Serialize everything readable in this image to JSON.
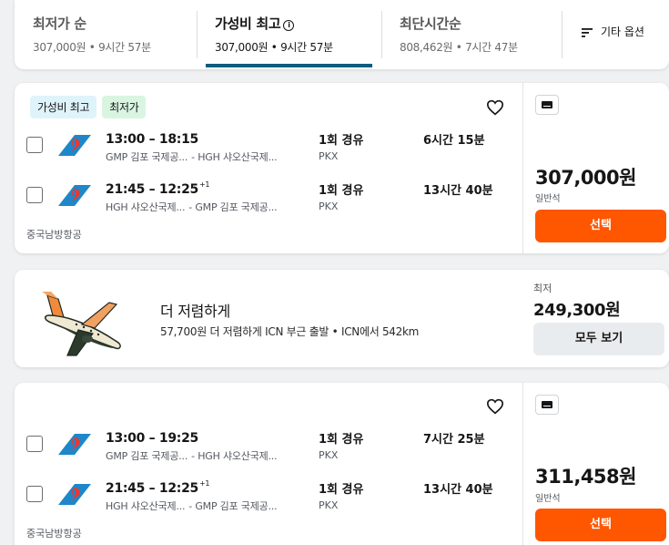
{
  "sort": {
    "tabs": [
      {
        "label": "최저가 순",
        "price": "307,000원",
        "duration": "9시간 57분"
      },
      {
        "label": "가성비 최고",
        "price": "307,000원",
        "duration": "9시간 57분"
      },
      {
        "label": "최단시간순",
        "price": "808,462원",
        "duration": "7시간 47분"
      }
    ],
    "dot": "•",
    "more_filters": "기타 옵션"
  },
  "results": [
    {
      "badges": [
        "가성비 최고",
        "최저가"
      ],
      "legs": [
        {
          "times": "13:00 – 18:15",
          "day_offset": "",
          "from": "GMP 김포 국제공...",
          "to": "- HGH 샤오산국제...",
          "stops": "1회 경유",
          "via": "PKX",
          "duration": "6시간 15분"
        },
        {
          "times": "21:45 – 12:25",
          "day_offset": "+1",
          "from": "HGH 샤오산국제...",
          "to": "- GMP 김포 국제공...",
          "stops": "1회 경유",
          "via": "PKX",
          "duration": "13시간 40분"
        }
      ],
      "airline": "중국남방항공",
      "price": "307,000원",
      "cabin": "일반석",
      "select_label": "선택"
    },
    {
      "badges": [],
      "legs": [
        {
          "times": "13:00 – 19:25",
          "day_offset": "",
          "from": "GMP 김포 국제공...",
          "to": "- HGH 샤오산국제...",
          "stops": "1회 경유",
          "via": "PKX",
          "duration": "7시간 25분"
        },
        {
          "times": "21:45 – 12:25",
          "day_offset": "+1",
          "from": "HGH 샤오산국제...",
          "to": "- GMP 김포 국제공...",
          "stops": "1회 경유",
          "via": "PKX",
          "duration": "13시간 40분"
        }
      ],
      "airline": "중국남방항공",
      "price": "311,458원",
      "cabin": "일반석",
      "select_label": "선택"
    }
  ],
  "promo": {
    "title": "더 저렴하게",
    "subtitle": "57,700원 더 저렴하게 ICN 부근 출발 • ICN에서 542km",
    "low_label": "최저",
    "low_price": "249,300원",
    "see_all": "모두 보기"
  },
  "colors": {
    "accent_button": "#ff5600",
    "active_tab_underline": "#0b5c7e",
    "badge_best": "#dff3fb",
    "badge_cheapest": "#d9f5e1",
    "airline_logo": "#1d87c9"
  }
}
